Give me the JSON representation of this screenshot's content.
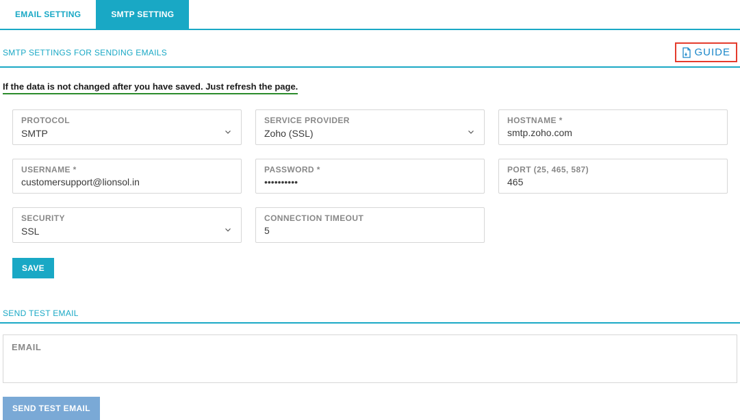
{
  "tabs": {
    "email_setting": "EMAIL SETTING",
    "smtp_setting": "SMTP SETTING"
  },
  "section1": {
    "title": "SMTP SETTINGS FOR SENDING EMAILS",
    "guide": "GUIDE"
  },
  "notice": "If the data is not changed after you have saved. Just refresh the page.",
  "fields": {
    "protocol": {
      "label": "PROTOCOL",
      "value": "SMTP"
    },
    "service_provider": {
      "label": "SERVICE PROVIDER",
      "value": "Zoho (SSL)"
    },
    "hostname": {
      "label": "HOSTNAME *",
      "value": "smtp.zoho.com"
    },
    "username": {
      "label": "USERNAME *",
      "value": "customersupport@lionsol.in"
    },
    "password": {
      "label": "PASSWORD *",
      "value": "••••••••••"
    },
    "port": {
      "label": "PORT (25, 465, 587)",
      "value": "465"
    },
    "security": {
      "label": "SECURITY",
      "value": "SSL"
    },
    "timeout": {
      "label": "CONNECTION TIMEOUT",
      "value": "5"
    }
  },
  "buttons": {
    "save": "SAVE",
    "send_test": "SEND TEST EMAIL"
  },
  "section2": {
    "title": "SEND TEST EMAIL"
  },
  "test_email": {
    "label": "EMAIL",
    "value": ""
  }
}
